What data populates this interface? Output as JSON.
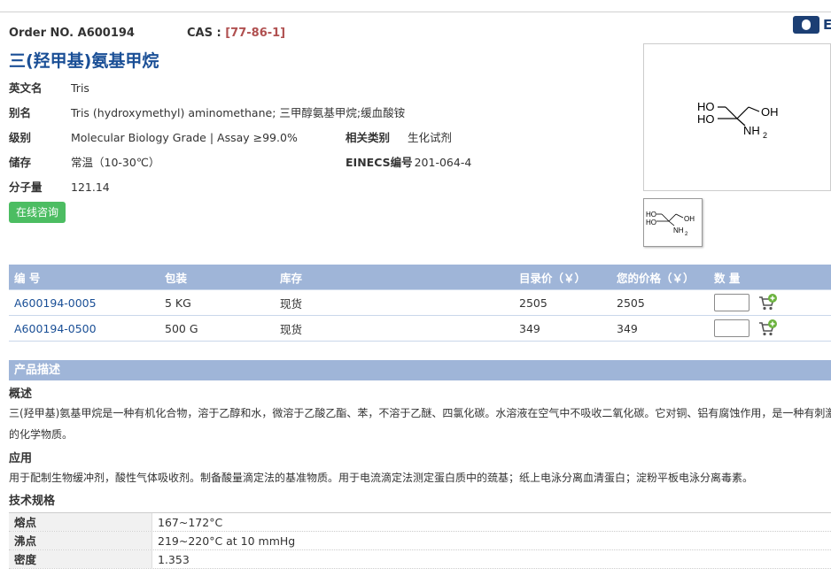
{
  "header": {
    "order_label": "Order NO. A600194",
    "cas_label": "CAS : ",
    "cas_value": "[77-86-1]",
    "logo_letter": "E",
    "title": "三(羟甲基)氨基甲烷"
  },
  "properties": {
    "english_name": {
      "key": "英文名",
      "value": "Tris"
    },
    "alias": {
      "key": "别名",
      "value": "Tris (hydroxymethyl) aminomethane; 三甲醇氨基甲烷;缓血酸铵"
    },
    "grade": {
      "key": "级别",
      "value": "Molecular Biology Grade | Assay ≥99.0%"
    },
    "storage": {
      "key": "储存",
      "value": "常温（10-30℃）"
    },
    "mw": {
      "key": "分子量",
      "value": "121.14"
    },
    "category": {
      "key": "相关类别",
      "value": "生化试剂"
    },
    "einecs": {
      "key": "EINECS编号",
      "value": "201-064-4"
    }
  },
  "consult_button": "在线咨询",
  "structure": {
    "ho1": "HO",
    "ho2": "HO",
    "oh": "OH",
    "nh2": "NH",
    "sub2": "2"
  },
  "table": {
    "headers": [
      "编 号",
      "包装",
      "库存",
      "目录价（￥）",
      "您的价格（￥）",
      "数 量"
    ],
    "rows": [
      {
        "code": "A600194-0005",
        "pack": "5 KG",
        "stock": "现货",
        "list_price": "2505",
        "your_price": "2505"
      },
      {
        "code": "A600194-0500",
        "pack": "500 G",
        "stock": "现货",
        "list_price": "349",
        "your_price": "349"
      }
    ]
  },
  "description": {
    "section_title": "产品描述",
    "overview_title": "概述",
    "overview_line1": "三(羟甲基)氨基甲烷是一种有机化合物，溶于乙醇和水，微溶于乙酸乙酯、苯，不溶于乙醚、四氯化碳。水溶液在空气中不吸收二氧化碳。它对铜、铝有腐蚀作用，是一种有刺激",
    "overview_line2": "的化学物质。",
    "application_title": "应用",
    "application_text": "用于配制生物缓冲剂，酸性气体吸收剂。制备酸量滴定法的基准物质。用于电流滴定法测定蛋白质中的巯基；纸上电泳分离血清蛋白；淀粉平板电泳分离毒素。",
    "spec_title": "技术规格"
  },
  "specs": [
    {
      "key": "熔点",
      "value": "167~172°C"
    },
    {
      "key": "沸点",
      "value": "219~220°C at 10 mmHg"
    },
    {
      "key": "密度",
      "value": "1.353"
    }
  ],
  "colors": {
    "brand_blue": "#1a4f96",
    "header_bar": "#9fb5d8",
    "consult_green": "#4cbd62",
    "link_red": "#c0504d"
  }
}
